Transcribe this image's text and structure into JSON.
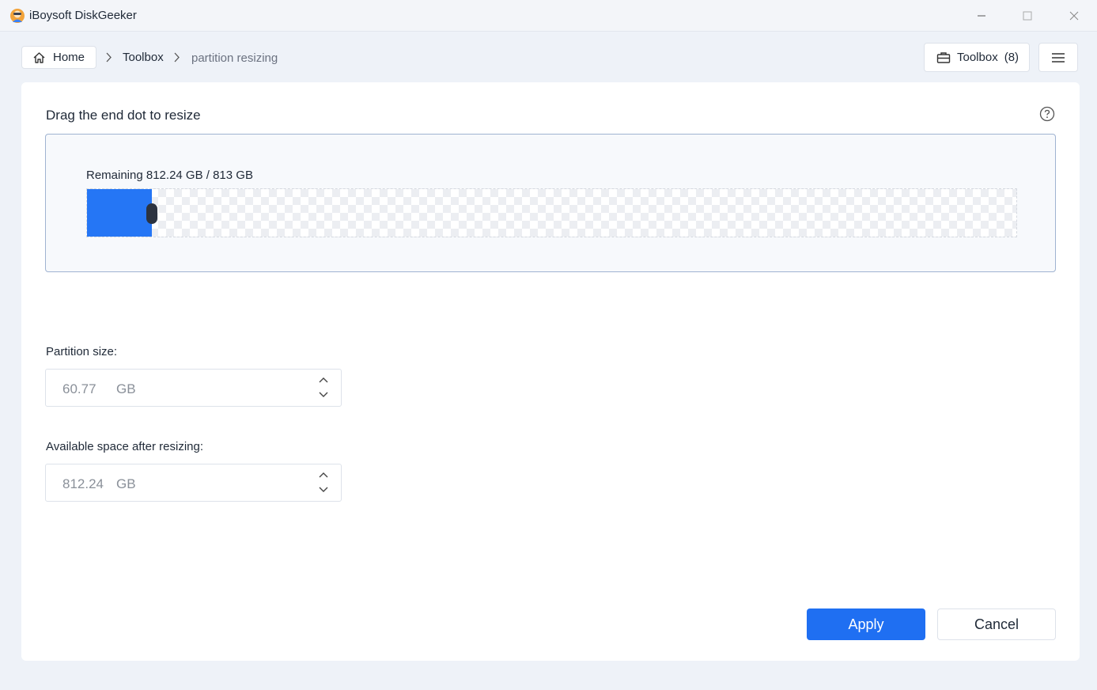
{
  "window": {
    "title": "iBoysoft DiskGeeker",
    "logo_icon": "app-logo-icon",
    "controls": [
      "minimize-icon",
      "maximize-icon",
      "close-icon"
    ]
  },
  "breadcrumb": {
    "home_label": "Home",
    "home_icon": "home-icon",
    "separator_icon": "chevron-right-icon",
    "toolbox_label": "Toolbox",
    "current_label": "partition resizing"
  },
  "header": {
    "toolbox_button_label": "Toolbox",
    "toolbox_count": "(8)",
    "toolbox_icon": "briefcase-icon",
    "menu_icon": "hamburger-menu-icon"
  },
  "resize": {
    "title": "Drag the end dot to resize",
    "help_icon": "question-circle-icon",
    "remaining_text": "Remaining 812.24 GB / 813 GB",
    "used_fraction": 0.07,
    "fill_color": "#2576f5"
  },
  "fields": {
    "partition_size_label": "Partition size:",
    "partition_size_value": "60.77",
    "partition_size_unit": "GB",
    "available_label": "Available space after resizing:",
    "available_value": "812.24",
    "available_unit": "GB"
  },
  "actions": {
    "apply_label": "Apply",
    "cancel_label": "Cancel",
    "accent_color": "#1f6ff2"
  }
}
